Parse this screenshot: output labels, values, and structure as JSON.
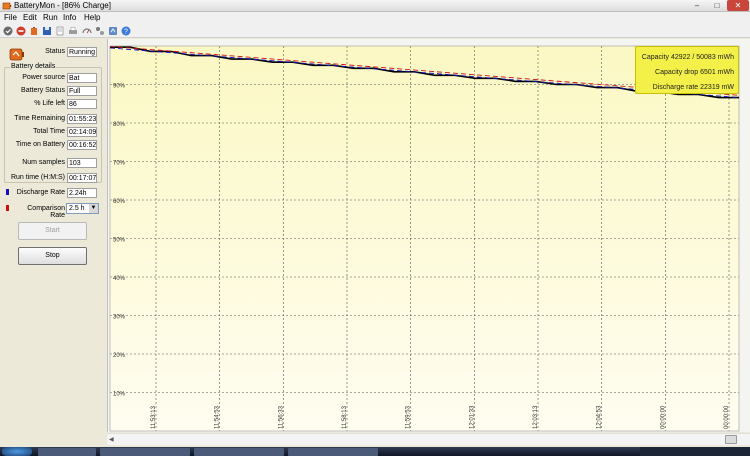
{
  "window": {
    "title": "BatteryMon - [86% Charge]"
  },
  "menu": [
    "File",
    "Edit",
    "Run",
    "Info",
    "Help"
  ],
  "toolbar_icons": [
    "start-icon",
    "stop-icon",
    "battery-icon",
    "save-icon",
    "document-icon",
    "print-icon",
    "gauge-icon",
    "config-icon",
    "settings-icon",
    "help-icon"
  ],
  "panel": {
    "status": {
      "label": "Status",
      "value": "Running"
    },
    "battery_details_title": "Battery details",
    "power_source": {
      "label": "Power source",
      "value": "Bat"
    },
    "battery_status": {
      "label": "Battery Status",
      "value": "Full"
    },
    "life_left": {
      "label": "% Life left",
      "value": "86"
    },
    "time_remaining": {
      "label": "Time Remaining",
      "value": "01:55:23"
    },
    "total_time": {
      "label": "Total Time",
      "value": "02:14:09"
    },
    "time_on_battery": {
      "label": "Time on Battery",
      "value": "00:16:52"
    },
    "num_samples": {
      "label": "Num samples",
      "value": "103"
    },
    "run_time": {
      "label": "Run time (H:M:S)",
      "value": "00:17:07"
    },
    "discharge_rate": {
      "label": "Discharge Rate",
      "value": "2.24h"
    },
    "comparison_rate": {
      "label": "Comparison Rate",
      "value": "2.5 h"
    },
    "start_label": "Start",
    "stop_label": "Stop"
  },
  "info_box": {
    "capacity": "Capacity 42922 / 50083 mWh",
    "capacity_drop": "Capacity drop 6501 mWh",
    "discharge_rate": "Discharge rate 22319 mW"
  },
  "colors": {
    "discharge": "#1010c0",
    "comparison": "#d01010",
    "charge_line": "#000000",
    "plot_top": "#fbf8c4",
    "plot_bottom": "#fffdf0"
  },
  "chart_data": {
    "type": "line",
    "ylim": [
      0,
      100
    ],
    "ytick_labels": [
      "90%",
      "80%",
      "70%",
      "60%",
      "50%",
      "40%",
      "30%",
      "20%",
      "10%"
    ],
    "x_tick_labels": [
      "11:53:13",
      "11:54:53",
      "11:56:33",
      "11:58:13",
      "11:59:53",
      "12:01:33",
      "12:03:13",
      "12:04:53",
      "00:00:00",
      "00:00:00"
    ],
    "series": [
      {
        "values": [
          99.7,
          99.7,
          98.6,
          98.6,
          97.5,
          97.5,
          96.6,
          96.6,
          95.8,
          95.8,
          95.0,
          95.0,
          94.2,
          94.2,
          93.3,
          93.3,
          92.4,
          92.4,
          91.6,
          91.6,
          90.8,
          90.8,
          90.0,
          90.0,
          89.2,
          89.2,
          88.2,
          88.2,
          87.4,
          87.4,
          86.6,
          86.6
        ]
      },
      {
        "values": [
          99.5,
          86.6
        ]
      },
      {
        "values": [
          99.9,
          87.2
        ]
      }
    ]
  }
}
